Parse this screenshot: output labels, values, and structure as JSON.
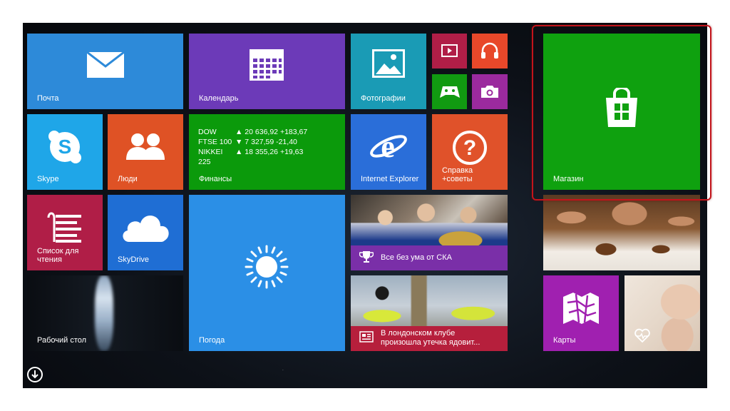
{
  "tiles": {
    "mail": {
      "label": "Почта",
      "color": "#2d8ad9"
    },
    "calendar": {
      "label": "Календарь",
      "color": "#6c3ab8"
    },
    "photos": {
      "label": "Фотографии",
      "color": "#1a9bb5"
    },
    "video": {
      "color": "#b01e47"
    },
    "music": {
      "color": "#e8482a"
    },
    "games": {
      "color": "#119a11"
    },
    "camera": {
      "color": "#9b2a9e"
    },
    "skype": {
      "label": "Skype",
      "color": "#1fa6e8"
    },
    "people": {
      "label": "Люди",
      "color": "#df5225"
    },
    "finance": {
      "label": "Финансы",
      "color": "#0b9a0b",
      "rows": [
        {
          "name": "DOW",
          "value": "▲ 20 636,92 +183,67"
        },
        {
          "name": "FTSE 100",
          "value": "▼ 7 327,59 -21,40"
        },
        {
          "name": "NIKKEI 225",
          "value": "▲ 18 355,26 +19,63"
        }
      ]
    },
    "ie": {
      "label": "Internet Explorer",
      "color": "#2a6ed9"
    },
    "help": {
      "label": "Справка\n+советы",
      "color": "#e0522a"
    },
    "store": {
      "label": "Магазин",
      "color": "#0fa10f"
    },
    "reading": {
      "label": "Список для\nчтения",
      "color": "#b01e47"
    },
    "skydrive": {
      "label": "SkyDrive",
      "color": "#1f6ed4"
    },
    "weather": {
      "label": "Погода",
      "color": "#2b8fe6"
    },
    "news1": {
      "text": "Все без ума от СКА",
      "color": "#7a2fa8"
    },
    "news2": {
      "text": "В лондонском клубе\nпроизошла утечка ядовит...",
      "color": "#b61f3c"
    },
    "desktop": {
      "label": "Рабочий стол"
    },
    "maps": {
      "label": "Карты",
      "color": "#a020b0"
    }
  },
  "icons": {
    "mail": "envelope-icon",
    "calendar": "calendar-icon",
    "photos": "landscape-photo-icon",
    "video": "video-icon",
    "music": "headphones-icon",
    "games": "gamepad-icon",
    "camera": "camera-icon",
    "skype": "skype-icon",
    "people": "people-icon",
    "ie": "internet-explorer-icon",
    "help": "question-icon",
    "store": "shopping-bag-icon",
    "reading": "reading-list-icon",
    "skydrive": "cloud-icon",
    "weather": "sun-icon",
    "maps": "map-icon",
    "all_apps": "down-arrow-icon"
  }
}
